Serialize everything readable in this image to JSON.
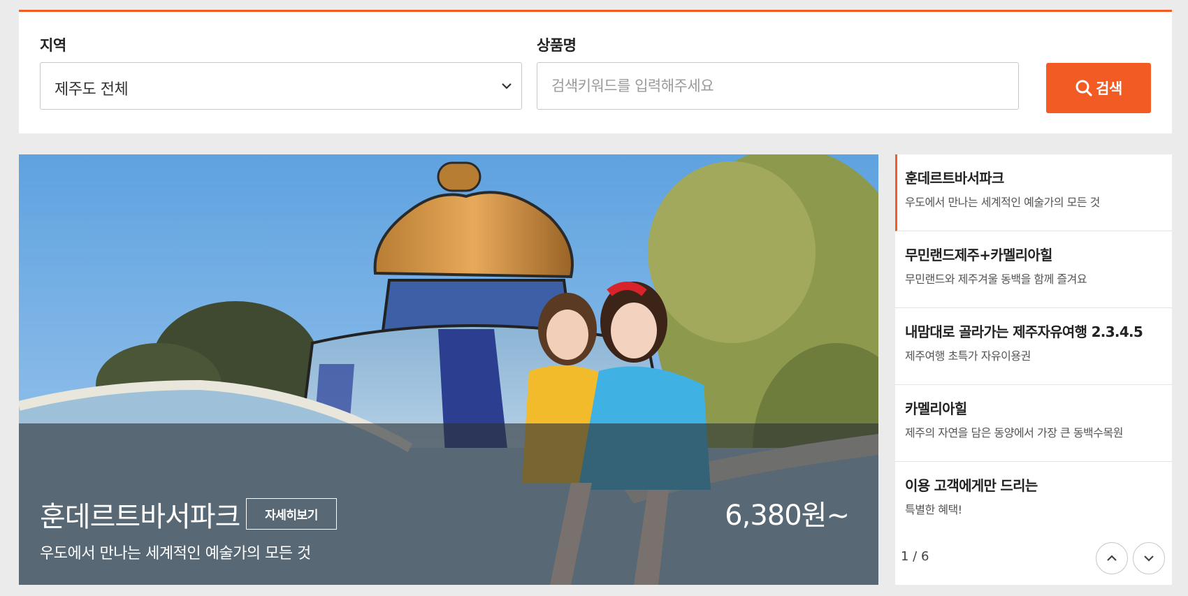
{
  "search": {
    "region_label": "지역",
    "region_value": "제주도 전체",
    "product_label": "상품명",
    "product_placeholder": "검색키워드를 입력해주세요",
    "button_label": "검색",
    "icons": {
      "button": "search-icon",
      "select": "chevron-down-icon"
    },
    "accent_color": "#f35b25"
  },
  "hero": {
    "title": "훈데르트바서파크",
    "detail_button": "자세히보기",
    "subtitle": "우도에서 만나는 세계적인 예술가의 모든 것",
    "price": "6,380원~"
  },
  "side_list": {
    "items": [
      {
        "title": "훈데르트바서파크",
        "desc": "우도에서 만나는 세계적인 예술가의 모든 것",
        "active": true
      },
      {
        "title": "무민랜드제주+카멜리아힐",
        "desc": "무민랜드와 제주겨울 동백을 함께 즐겨요",
        "active": false
      },
      {
        "title": "내맘대로 골라가는 제주자유여행 2.3.4.5",
        "desc": "제주여행 초특가 자유이용권",
        "active": false
      },
      {
        "title": "카멜리아힐",
        "desc": "제주의 자연을 담은 동양에서 가장 큰 동백수목원",
        "active": false
      },
      {
        "title": "이용 고객에게만 드리는",
        "desc": "특별한 혜택!",
        "active": false
      }
    ],
    "pager": "1 / 6",
    "icons": {
      "prev": "chevron-up-icon",
      "next": "chevron-down-icon"
    }
  }
}
